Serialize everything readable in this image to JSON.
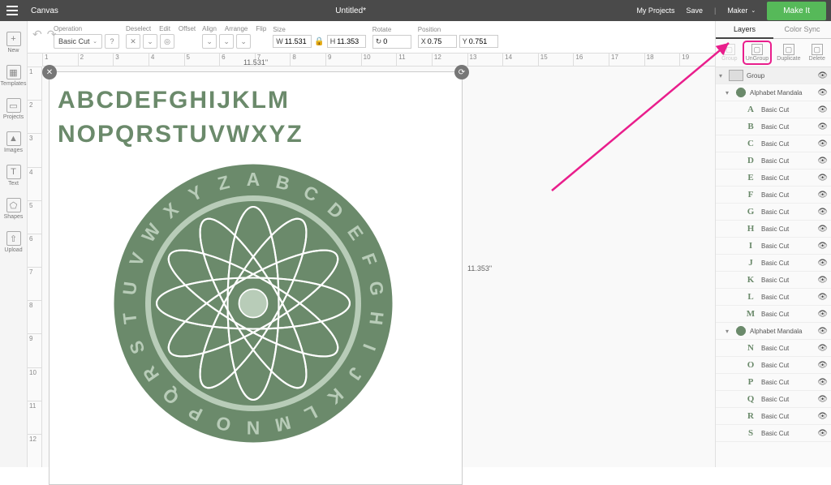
{
  "topbar": {
    "title_left": "Canvas",
    "title_center": "Untitled*",
    "my_projects": "My Projects",
    "save": "Save",
    "machine": "Maker",
    "make_it": "Make It"
  },
  "options": {
    "operation_label": "Operation",
    "operation_value": "Basic Cut",
    "deselect": "Deselect",
    "edit": "Edit",
    "offset": "Offset",
    "align": "Align",
    "arrange": "Arrange",
    "flip": "Flip",
    "size": "Size",
    "size_w": "11.531",
    "size_h": "11.353",
    "rotate": "Rotate",
    "rotate_v": "0",
    "position": "Position",
    "pos_x": "0.75",
    "pos_y": "0.751"
  },
  "leftbar": [
    {
      "icon": "+",
      "label": "New"
    },
    {
      "icon": "▦",
      "label": "Templates"
    },
    {
      "icon": "▭",
      "label": "Projects"
    },
    {
      "icon": "▲",
      "label": "Images"
    },
    {
      "icon": "T",
      "label": "Text"
    },
    {
      "icon": "⬠",
      "label": "Shapes"
    },
    {
      "icon": "⇧",
      "label": "Upload"
    }
  ],
  "canvas": {
    "dim_top": "11.531\"",
    "dim_right": "11.353\"",
    "ruler_h": [
      "1",
      "2",
      "3",
      "4",
      "5",
      "6",
      "7",
      "8",
      "9",
      "10",
      "11",
      "12",
      "13",
      "14",
      "15",
      "16",
      "17",
      "18",
      "19"
    ],
    "ruler_v": [
      "1",
      "2",
      "3",
      "4",
      "5",
      "6",
      "7",
      "8",
      "9",
      "10",
      "11",
      "12"
    ],
    "alphabet_row1": "ABCDEFGHIJKLM",
    "alphabet_row2": "NOPQRSTUVWXYZ"
  },
  "rightpanel": {
    "tab_layers": "Layers",
    "tab_colorsync": "Color Sync",
    "tools": [
      {
        "label": "Group",
        "disabled": true
      },
      {
        "label": "UnGroup",
        "highlight": true
      },
      {
        "label": "Duplicate"
      },
      {
        "label": "Delete"
      }
    ],
    "rows": [
      {
        "type": "group",
        "label": "Group",
        "tw": "▾"
      },
      {
        "type": "sub",
        "label": "Alphabet Mandala",
        "tw": "▾",
        "thumb": "mandala"
      },
      {
        "type": "letter",
        "letter": "A",
        "label": "Basic Cut"
      },
      {
        "type": "letter",
        "letter": "B",
        "label": "Basic Cut"
      },
      {
        "type": "letter",
        "letter": "C",
        "label": "Basic Cut"
      },
      {
        "type": "letter",
        "letter": "D",
        "label": "Basic Cut"
      },
      {
        "type": "letter",
        "letter": "E",
        "label": "Basic Cut"
      },
      {
        "type": "letter",
        "letter": "F",
        "label": "Basic Cut"
      },
      {
        "type": "letter",
        "letter": "G",
        "label": "Basic Cut"
      },
      {
        "type": "letter",
        "letter": "H",
        "label": "Basic Cut"
      },
      {
        "type": "letter",
        "letter": "I",
        "label": "Basic Cut"
      },
      {
        "type": "letter",
        "letter": "J",
        "label": "Basic Cut"
      },
      {
        "type": "letter",
        "letter": "K",
        "label": "Basic Cut"
      },
      {
        "type": "letter",
        "letter": "L",
        "label": "Basic Cut"
      },
      {
        "type": "letter",
        "letter": "M",
        "label": "Basic Cut"
      },
      {
        "type": "sub",
        "label": "Alphabet Mandala",
        "tw": "▾",
        "thumb": "mandala"
      },
      {
        "type": "letter",
        "letter": "N",
        "label": "Basic Cut"
      },
      {
        "type": "letter",
        "letter": "O",
        "label": "Basic Cut"
      },
      {
        "type": "letter",
        "letter": "P",
        "label": "Basic Cut"
      },
      {
        "type": "letter",
        "letter": "Q",
        "label": "Basic Cut"
      },
      {
        "type": "letter",
        "letter": "R",
        "label": "Basic Cut"
      },
      {
        "type": "letter",
        "letter": "S",
        "label": "Basic Cut"
      }
    ]
  },
  "colors": {
    "green": "#6b8a6b",
    "lightgreen": "#b8ccb8",
    "pink": "#e91e8c",
    "cricut": "#56b959"
  }
}
